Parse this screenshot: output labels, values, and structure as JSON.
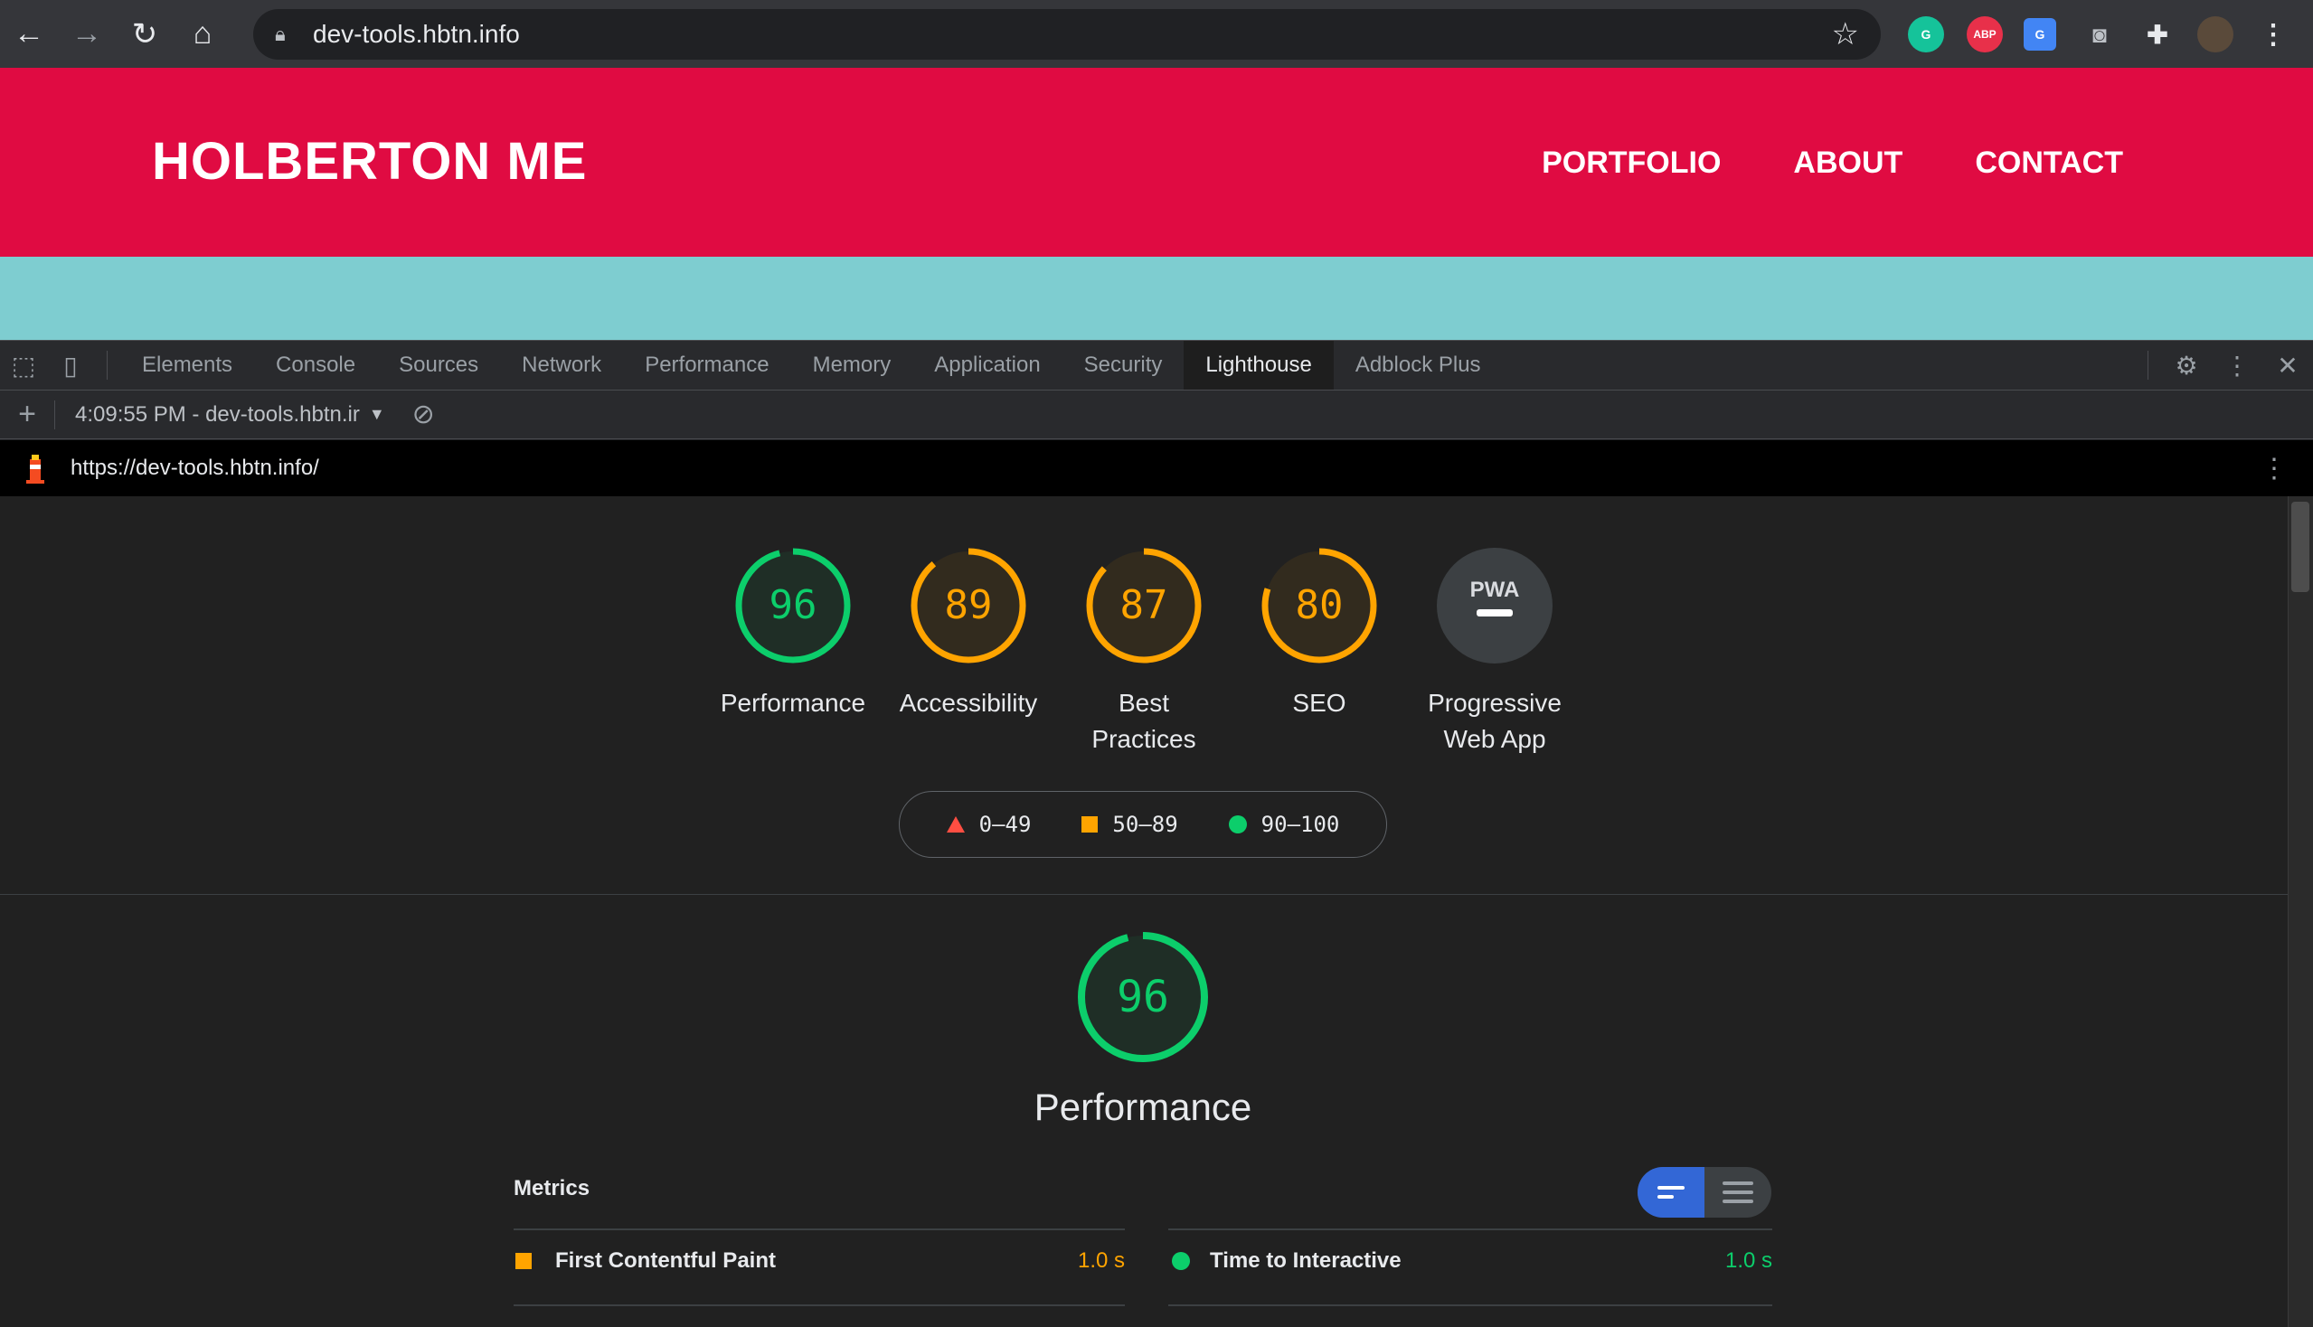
{
  "browser": {
    "url": "dev-tools.hbtn.info",
    "extensions": [
      "grammarly-icon",
      "adblock-plus-icon",
      "google-translate-icon",
      "camera-icon",
      "puzzle-icon",
      "avatar"
    ],
    "abp_label": "ABP"
  },
  "site": {
    "title": "HOLBERTON ME",
    "nav": [
      "PORTFOLIO",
      "ABOUT",
      "CONTACT"
    ],
    "header_color": "#e00b42",
    "strip_color": "#7ecdd0"
  },
  "devtools": {
    "tabs": [
      "Elements",
      "Console",
      "Sources",
      "Network",
      "Performance",
      "Memory",
      "Application",
      "Security",
      "Lighthouse",
      "Adblock Plus"
    ],
    "active_tab": "Lighthouse",
    "run_label": "4:09:55 PM - dev-tools.hbtn.ir",
    "report_url": "https://dev-tools.hbtn.info/"
  },
  "scores": [
    {
      "label": "Performance",
      "value": "96",
      "color": "#0cce6b",
      "fraction": 0.96
    },
    {
      "label": "Accessibility",
      "value": "89",
      "color": "#ffa400",
      "fraction": 0.89
    },
    {
      "label": "Best Practices",
      "value": "87",
      "color": "#ffa400",
      "fraction": 0.87
    },
    {
      "label": "SEO",
      "value": "80",
      "color": "#ffa400",
      "fraction": 0.8
    },
    {
      "label": "Progressive Web App",
      "value": "PWA",
      "color": "#9aa0a6"
    }
  ],
  "legend": {
    "fail": "0–49",
    "average": "50–89",
    "pass": "90–100"
  },
  "performance": {
    "score": "96",
    "title": "Performance",
    "metrics_heading": "Metrics",
    "metrics": [
      {
        "name": "First Contentful Paint",
        "value": "1.0 s",
        "status": "average",
        "color": "#ffa400"
      },
      {
        "name": "Time to Interactive",
        "value": "1.0 s",
        "status": "pass",
        "color": "#0cce6b"
      }
    ]
  }
}
